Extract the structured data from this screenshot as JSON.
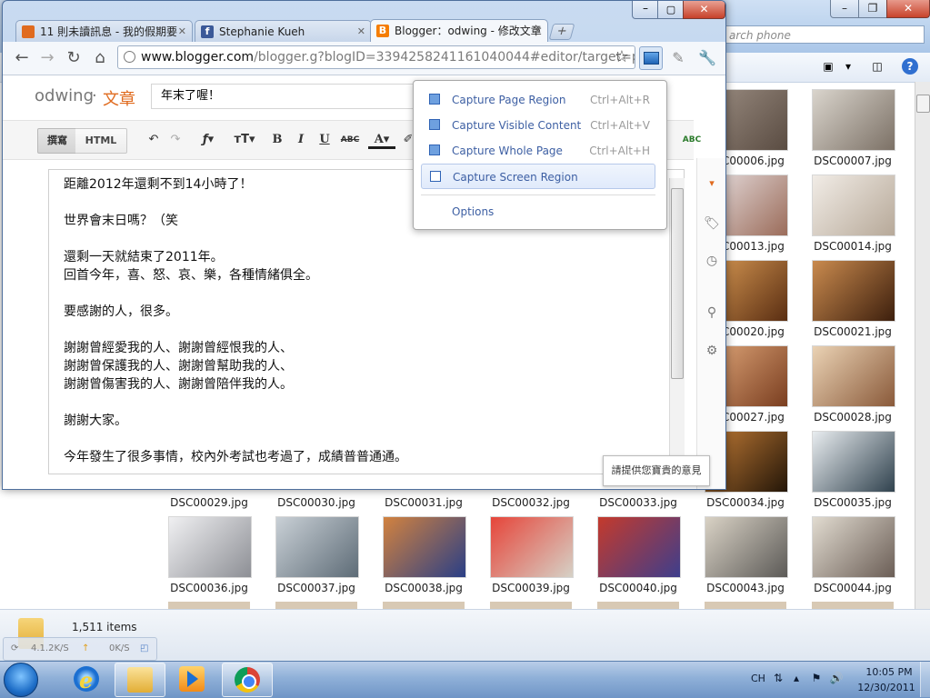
{
  "explorer": {
    "search_placeholder": "arch phone",
    "items_count": "1,511 items",
    "net_up": "4.1.2K/S",
    "net_down": "0K/S",
    "thumbnails": [
      {
        "name": "DSC00006.jpg",
        "c1": "#9b8d82",
        "c2": "#5a4c42"
      },
      {
        "name": "DSC00007.jpg",
        "c1": "#d9d4cc",
        "c2": "#7c7166"
      },
      {
        "name": "DSC00013.jpg",
        "c1": "#e7dfe0",
        "c2": "#9b6c5a"
      },
      {
        "name": "DSC00014.jpg",
        "c1": "#f1ece6",
        "c2": "#b7a999"
      },
      {
        "name": "DSC00020.jpg",
        "c1": "#d99a54",
        "c2": "#5a2e12"
      },
      {
        "name": "DSC00021.jpg",
        "c1": "#c98a4e",
        "c2": "#3d1f0d"
      },
      {
        "name": "DSC00027.jpg",
        "c1": "#e0a77a",
        "c2": "#7a3e20"
      },
      {
        "name": "DSC00028.jpg",
        "c1": "#ead2b4",
        "c2": "#8a5a3a"
      },
      {
        "name": "DSC00029.jpg",
        "c1": "#ffffff",
        "c2": "#ffffff"
      },
      {
        "name": "DSC00030.jpg",
        "c1": "#ffffff",
        "c2": "#ffffff"
      },
      {
        "name": "DSC00031.jpg",
        "c1": "#ffffff",
        "c2": "#ffffff"
      },
      {
        "name": "DSC00032.jpg",
        "c1": "#ffffff",
        "c2": "#ffffff"
      },
      {
        "name": "DSC00033.jpg",
        "c1": "#ffffff",
        "c2": "#ffffff"
      },
      {
        "name": "DSC00034.jpg",
        "c1": "#c07a35",
        "c2": "#241608"
      },
      {
        "name": "DSC00035.jpg",
        "c1": "#e8ecef",
        "c2": "#30424e"
      },
      {
        "name": "DSC00036.jpg",
        "c1": "#f0f0f2",
        "c2": "#8d8f95"
      },
      {
        "name": "DSC00037.jpg",
        "c1": "#c9d0d6",
        "c2": "#5e6c77"
      },
      {
        "name": "DSC00038.jpg",
        "c1": "#d2823f",
        "c2": "#2a3f86"
      },
      {
        "name": "DSC00039.jpg",
        "c1": "#e6453a",
        "c2": "#d6d1c6"
      },
      {
        "name": "DSC00040.jpg",
        "c1": "#c43a2c",
        "c2": "#3e3e8c"
      },
      {
        "name": "DSC00043.jpg",
        "c1": "#d9d2c5",
        "c2": "#5c5a57"
      },
      {
        "name": "DSC00044.jpg",
        "c1": "#e1dbd0",
        "c2": "#6b5e56"
      }
    ]
  },
  "chrome": {
    "tabs": [
      {
        "title": "11 則未讀訊息 - 我的假期要",
        "fav_color": "#e06b1f"
      },
      {
        "title": "Stephanie Kueh",
        "fav_color": "#3b5998"
      },
      {
        "title": "Blogger：odwing - 修改文章",
        "fav_color": "#f57d00"
      }
    ],
    "url_host": "www.blogger.com",
    "url_rest": "/blogger.g?blogID=3394258241161040044#editor/target=p",
    "blog_name": "odwing",
    "blog_section": "文章",
    "post_title": "年末了喔！",
    "mode_compose": "撰寫",
    "mode_html": "HTML",
    "body_lines": [
      "距離2012年還剩不到14小時了！",
      "",
      "世界會末日嗎？（笑",
      "",
      "還剩一天就結束了2011年。",
      "回首今年，喜、怒、哀、樂，各種情緒俱全。",
      "",
      "要感謝的人，很多。",
      "",
      "謝謝曾經愛我的人、謝謝曾經恨我的人、",
      "謝謝曾保護我的人、謝謝曾幫助我的人、",
      "謝謝曾傷害我的人、謝謝曾陪伴我的人。",
      "",
      "謝謝大家。",
      "",
      "今年發生了很多事情，校內外考試也考過了，成績普普通通。"
    ],
    "feedback": "請提供您寶貴的意見",
    "toolbar_labels": {
      "bold": "B",
      "italic": "I",
      "underline": "U",
      "strike": "ABC",
      "font": "ƒ",
      "size": "тT",
      "color": "A",
      "spell": "ABC"
    }
  },
  "capture_menu": {
    "items": [
      {
        "label": "Capture Page Region",
        "shortcut": "Ctrl+Alt+R"
      },
      {
        "label": "Capture Visible Content",
        "shortcut": "Ctrl+Alt+V"
      },
      {
        "label": "Capture Whole Page",
        "shortcut": "Ctrl+Alt+H"
      },
      {
        "label": "Capture Screen Region",
        "shortcut": ""
      }
    ],
    "options_label": "Options"
  },
  "taskbar": {
    "lang": "CH",
    "time": "10:05 PM",
    "date": "12/30/2011"
  }
}
